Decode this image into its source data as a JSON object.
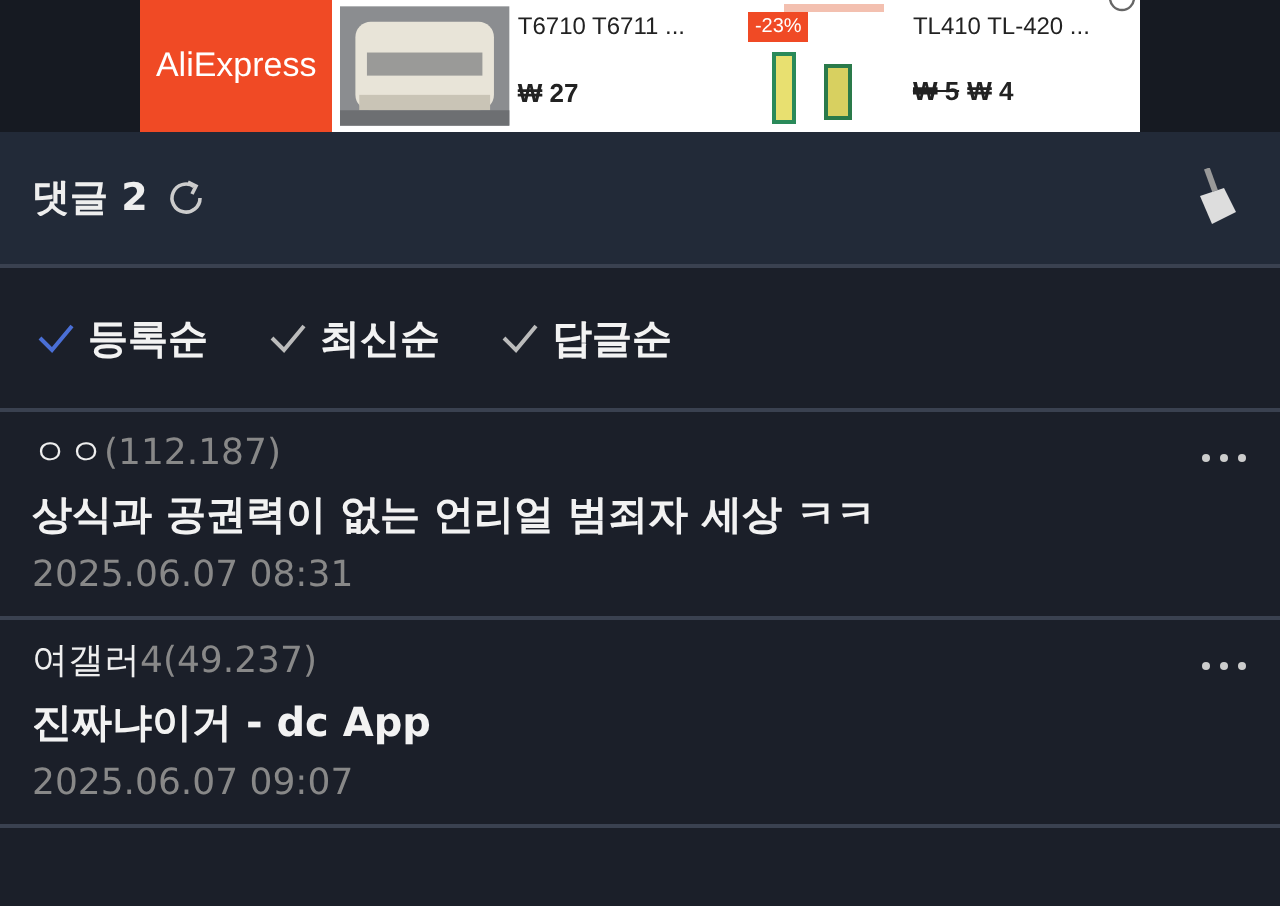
{
  "ad": {
    "brand": "AliExpress",
    "products": [
      {
        "title": "T6710 T6711 ...",
        "price": "₩ 27"
      },
      {
        "badge": "-23%",
        "title": "TL410 TL-420 ...",
        "old_price": "₩ 5",
        "price": "₩ 4"
      }
    ]
  },
  "comments_header": {
    "title": "댓글 2"
  },
  "sort_options": [
    {
      "label": "등록순",
      "selected": true
    },
    {
      "label": "최신순",
      "selected": false
    },
    {
      "label": "답글순",
      "selected": false
    }
  ],
  "comments": [
    {
      "author": "ㅇㅇ",
      "ip": "(112.187)",
      "text": "상식과 공권력이 없는 언리얼 범죄자 세상 ㅋㅋ",
      "date": "2025.06.07 08:31"
    },
    {
      "author": "여갤러",
      "ip": "4(49.237)",
      "text": "진짜냐이거 - dc App",
      "date": "2025.06.07 09:07"
    }
  ]
}
